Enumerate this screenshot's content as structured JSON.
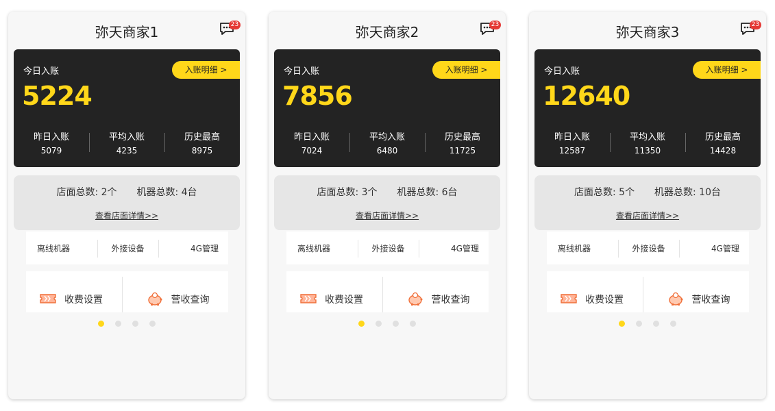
{
  "accent_color": "#ffd71a",
  "cards": [
    {
      "title": "弥天商家1",
      "message_badge": "23",
      "today_label": "今日入账",
      "detail_button": "入账明细 >",
      "today_value": "5224",
      "stats": [
        {
          "label": "昨日入账",
          "value": "5079"
        },
        {
          "label": "平均入账",
          "value": "4235"
        },
        {
          "label": "历史最高",
          "value": "8975"
        }
      ],
      "store_count_label": "店面总数:",
      "store_count": "2个",
      "machine_count_label": "机器总数:",
      "machine_count": "4台",
      "store_detail_link": "查看店面详情>>",
      "menu_row1": [
        "离线机器",
        "外接设备",
        "4G管理"
      ],
      "menu_row2": [
        {
          "label": "收费设置",
          "icon": "ticket-icon"
        },
        {
          "label": "营收查询",
          "icon": "piggy-bank-icon"
        }
      ],
      "page_dots": 4,
      "active_dot": 0
    },
    {
      "title": "弥天商家2",
      "message_badge": "23",
      "today_label": "今日入账",
      "detail_button": "入账明细 >",
      "today_value": "7856",
      "stats": [
        {
          "label": "昨日入账",
          "value": "7024"
        },
        {
          "label": "平均入账",
          "value": "6480"
        },
        {
          "label": "历史最高",
          "value": "11725"
        }
      ],
      "store_count_label": "店面总数:",
      "store_count": "3个",
      "machine_count_label": "机器总数:",
      "machine_count": "6台",
      "store_detail_link": "查看店面详情>>",
      "menu_row1": [
        "离线机器",
        "外接设备",
        "4G管理"
      ],
      "menu_row2": [
        {
          "label": "收费设置",
          "icon": "ticket-icon"
        },
        {
          "label": "营收查询",
          "icon": "piggy-bank-icon"
        }
      ],
      "page_dots": 4,
      "active_dot": 0
    },
    {
      "title": "弥天商家3",
      "message_badge": "23",
      "today_label": "今日入账",
      "detail_button": "入账明细 >",
      "today_value": "12640",
      "stats": [
        {
          "label": "昨日入账",
          "value": "12587"
        },
        {
          "label": "平均入账",
          "value": "11350"
        },
        {
          "label": "历史最高",
          "value": "14428"
        }
      ],
      "store_count_label": "店面总数:",
      "store_count": "5个",
      "machine_count_label": "机器总数:",
      "machine_count": "10台",
      "store_detail_link": "查看店面详情>>",
      "menu_row1": [
        "离线机器",
        "外接设备",
        "4G管理"
      ],
      "menu_row2": [
        {
          "label": "收费设置",
          "icon": "ticket-icon"
        },
        {
          "label": "营收查询",
          "icon": "piggy-bank-icon"
        }
      ],
      "page_dots": 4,
      "active_dot": 0
    }
  ]
}
